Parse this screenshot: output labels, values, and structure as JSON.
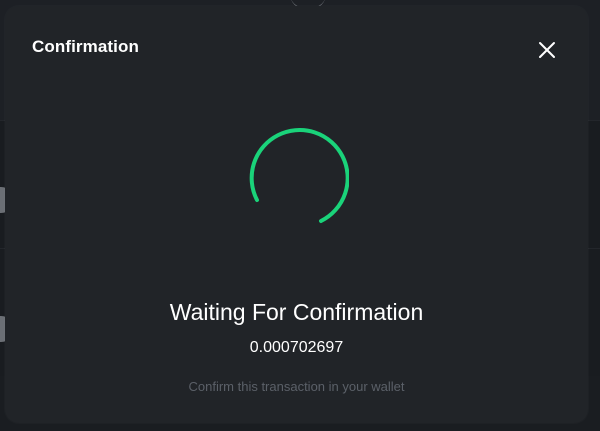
{
  "modal": {
    "title": "Confirmation",
    "close_icon": "close-icon",
    "spinner_icon": "loading-spinner-icon",
    "status_title": "Waiting For Confirmation",
    "amount": "0.000702697",
    "hint": "Confirm this transaction in your wallet"
  },
  "colors": {
    "modal_bg": "#212428",
    "spinner": "#1ad37a",
    "hint_text": "#5b6068"
  }
}
